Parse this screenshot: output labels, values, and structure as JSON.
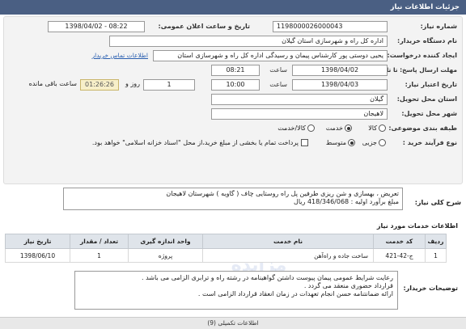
{
  "header": {
    "title": "جزئیات اطلاعات نیاز"
  },
  "form": {
    "need_number_label": "شماره نیاز:",
    "need_number": "1198000026000043",
    "announce_label": "تاریخ و ساعت اعلان عمومی:",
    "announce_value": "1398/04/02 - 08:22",
    "buyer_label": "نام دستگاه خریدار:",
    "buyer_value": "اداره کل راه و شهرسازی استان گیلان",
    "creator_label": "ایجاد کننده درخواست:",
    "creator_value": "یحیی دوستی پور کارشناس پیمان و رسیدگی اداره کل راه و شهرسازی استان",
    "contact_link": "اطلاعات تماس خریدار",
    "reply_deadline_label": "مهلت ارسال پاسخ: تا تاریخ:",
    "reply_date": "1398/04/02",
    "time_label": "ساعت",
    "reply_time": "08:21",
    "validity_label": "تاریخ اعتبار نیاز:",
    "validity_date": "1398/04/03",
    "validity_time": "10:00",
    "days_value": "1",
    "days_label": "روز و",
    "remaining_time": "01:26:26",
    "remaining_label": "ساعت باقی مانده",
    "province_label": "استان محل تحویل:",
    "province_value": "گیلان",
    "city_label": "شهر محل تحویل:",
    "city_value": "لاهیجان",
    "category_label": "طبقه بندی موضوعی:",
    "category_options": [
      "کالا",
      "خدمت",
      "کالا/خدمت"
    ],
    "category_selected": "خدمت",
    "purchase_label": "نوع فرآیند خرید :",
    "purchase_options": [
      "جزیی",
      "متوسط"
    ],
    "purchase_selected": "متوسط",
    "payment_note": "پرداخت تمام یا بخشی از مبلغ خرید،از محل \"اسناد خزانه اسلامی\" خواهد بود."
  },
  "general_desc": {
    "label": "شرح کلی نیاز:",
    "line1": "تعریض ، بهسازی و شن ریزی طرفین پل راه روستایی چاف ( گاویه ) شهرستان لاهیجان",
    "line2": "مبلغ برآورد اولیه : 418/346/068 ریال"
  },
  "services": {
    "title": "اطلاعات خدمات مورد نیاز",
    "headers": [
      "ردیف",
      "کد خدمت",
      "نام خدمت",
      "واحد اندازه گیری",
      "تعداد / مقدار",
      "تاریخ نیاز"
    ],
    "rows": [
      [
        "1",
        "ج-42-421",
        "ساخت جاده و راه‌آهن",
        "پروژه",
        "1",
        "1398/06/10"
      ]
    ]
  },
  "buyer_notes": {
    "label": "توضیحات خریدار:",
    "line1": "رعایت شرایط عمومی پیمان پیوست داشتن گواهینامه در رشته راه و ترابری الزامی می باشد .",
    "line2": "قرارداد حضوری منعقد می گردد .",
    "line3": "ارائه ضمانتنامه حسن انجام تعهدات در زمان انعقاد قرارداد الزامی است ."
  },
  "watermark": {
    "line1": "پایگاه اطلاع رسانی مناقصه و مزایده",
    "line2": "۰۲۱-۸۸۳۴۹۶۷۰"
  },
  "bottom": {
    "text": "اطلاعات تکمیلی     (9)"
  }
}
